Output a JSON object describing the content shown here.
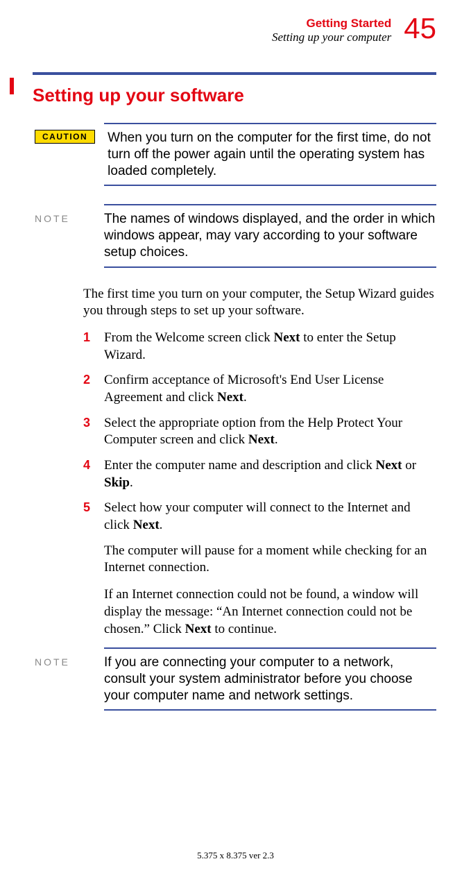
{
  "header": {
    "chapter": "Getting Started",
    "subtitle": "Setting up your computer",
    "page_number": "45"
  },
  "heading": "Setting up your software",
  "caution": {
    "label": "CAUTION",
    "text": "When you turn on the computer for the first time, do not turn off the power again until the operating system has loaded completely."
  },
  "note1": {
    "label": "NOTE",
    "text": "The names of windows displayed, and the order in which windows appear, may vary according to your software setup choices."
  },
  "intro": "The first time you turn on your computer, the Setup Wizard guides you through steps to set up your software.",
  "steps": [
    {
      "n": "1",
      "pre": "From the Welcome screen click ",
      "b1": "Next",
      "post": " to enter the Setup Wizard."
    },
    {
      "n": "2",
      "pre": "Confirm acceptance of Microsoft's End User License Agreement and click ",
      "b1": "Next",
      "post": "."
    },
    {
      "n": "3",
      "pre": "Select the appropriate option from the Help Protect Your Computer screen and click ",
      "b1": "Next",
      "post": "."
    },
    {
      "n": "4",
      "pre": "Enter the computer name and description and click ",
      "b1": "Next",
      "mid": " or ",
      "b2": "Skip",
      "post": "."
    },
    {
      "n": "5",
      "pre": "Select how your computer will connect to the Internet and click ",
      "b1": "Next",
      "post": "."
    }
  ],
  "sub1": "The computer will pause for a moment while checking for an Internet connection.",
  "sub2_pre": "If an Internet connection could not be found, a window will display the message: “An Internet connection could not be chosen.” Click ",
  "sub2_b": "Next",
  "sub2_post": " to continue.",
  "note2": {
    "label": "NOTE",
    "text": "If you are connecting your computer to a network, consult your system administrator before you choose your computer name and network settings."
  },
  "footer": "5.375 x 8.375 ver 2.3"
}
